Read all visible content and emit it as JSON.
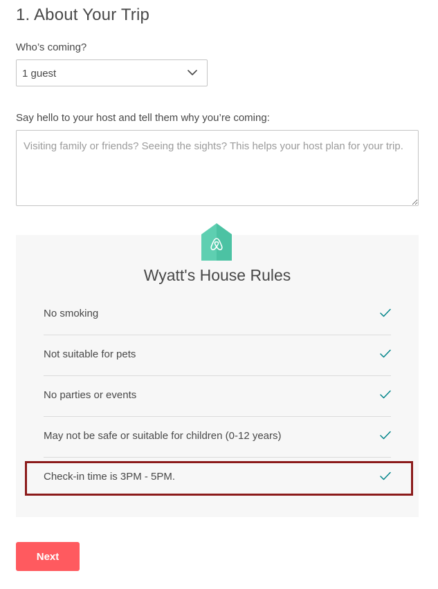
{
  "trip": {
    "section_title": "1. About Your Trip",
    "guests_label": "Who’s coming?",
    "guests_value": "1 guest",
    "guests_icon": "chevron-down-icon",
    "message_label": "Say hello to your host and tell them why you’re coming:",
    "message_placeholder": "Visiting family or friends? Seeing the sights? This helps your host plan for your trip.",
    "message_value": ""
  },
  "house_rules": {
    "logo_icon": "airbnb-house-logo-icon",
    "title": "Wyatt's House Rules",
    "items": [
      {
        "label": "No smoking",
        "icon": "check-icon"
      },
      {
        "label": "Not suitable for pets",
        "icon": "check-icon"
      },
      {
        "label": "No parties or events",
        "icon": "check-icon"
      },
      {
        "label": "May not be safe or suitable for children (0-12 years)",
        "icon": "check-icon"
      },
      {
        "label": "Check-in time is 3PM - 5PM.",
        "icon": "check-icon"
      }
    ]
  },
  "actions": {
    "next_label": "Next"
  },
  "colors": {
    "accent": "#ff5a5f",
    "logo_teal": "#5ecfb1",
    "check_teal": "#008489",
    "highlight": "#8b1a1a",
    "panel_bg": "#f7f7f7",
    "text": "#484848"
  }
}
